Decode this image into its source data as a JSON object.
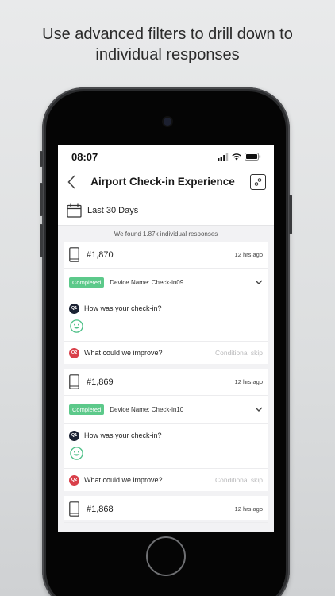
{
  "caption": {
    "line1": "Use advanced filters to drill down to",
    "line2": "individual responses"
  },
  "status_bar": {
    "time": "08:07"
  },
  "header": {
    "title": "Airport Check-in Experience"
  },
  "date_filter": {
    "label": "Last 30 Days"
  },
  "results_text": "We found 1.87k individual responses",
  "responses": [
    {
      "number": "#1,870",
      "time": "12 hrs ago",
      "status": "Completed",
      "device": "Device Name: Check-in09",
      "q1": {
        "label": "Q1",
        "text": "How was your check-in?"
      },
      "q2": {
        "label": "Q2",
        "text": "What could we improve?",
        "note": "Conditional skip"
      }
    },
    {
      "number": "#1,869",
      "time": "12 hrs ago",
      "status": "Completed",
      "device": "Device Name: Check-in10",
      "q1": {
        "label": "Q1",
        "text": "How was your check-in?"
      },
      "q2": {
        "label": "Q2",
        "text": "What could we improve?",
        "note": "Conditional skip"
      }
    },
    {
      "number": "#1,868",
      "time": "12 hrs ago"
    }
  ],
  "colors": {
    "completed": "#5cc98a",
    "q1": "#1b2233",
    "q2": "#d9404a",
    "smiley": "#4cbf86"
  }
}
